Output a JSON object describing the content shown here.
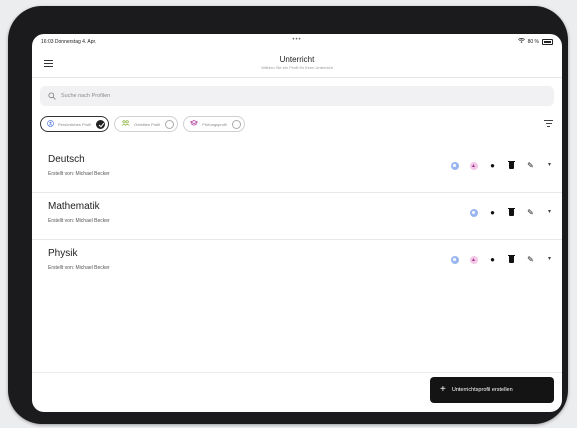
{
  "status_bar": {
    "time_date": "16:03  Donnerstag 4. Apr.",
    "dots": "•••",
    "battery_text": "80 %"
  },
  "header": {
    "title": "Unterricht",
    "subtitle": "Wählen Sie ein Profil für Ihren Unterricht"
  },
  "search": {
    "placeholder": "Suche nach Profilen"
  },
  "chips": [
    {
      "label": "Persönliches Profil",
      "icon": "user-circle-icon",
      "selected": true,
      "color": "#5b7fd6"
    },
    {
      "label": "Geteiltes Profil",
      "icon": "people-icon",
      "selected": false,
      "color": "#8cb33a"
    },
    {
      "label": "Prüfungsprofil",
      "icon": "graduation-cap-icon",
      "selected": false,
      "color": "#b0359a"
    }
  ],
  "profiles": [
    {
      "title": "Deutsch",
      "author": "Erstellt von: Michael Becker",
      "has_exam": true
    },
    {
      "title": "Mathematik",
      "author": "Erstellt von: Michael Becker",
      "has_exam": false
    },
    {
      "title": "Physik",
      "author": "Erstellt von: Michael Becker",
      "has_exam": true
    }
  ],
  "fab": {
    "label": "Unterrichtsprofil erstellen"
  }
}
